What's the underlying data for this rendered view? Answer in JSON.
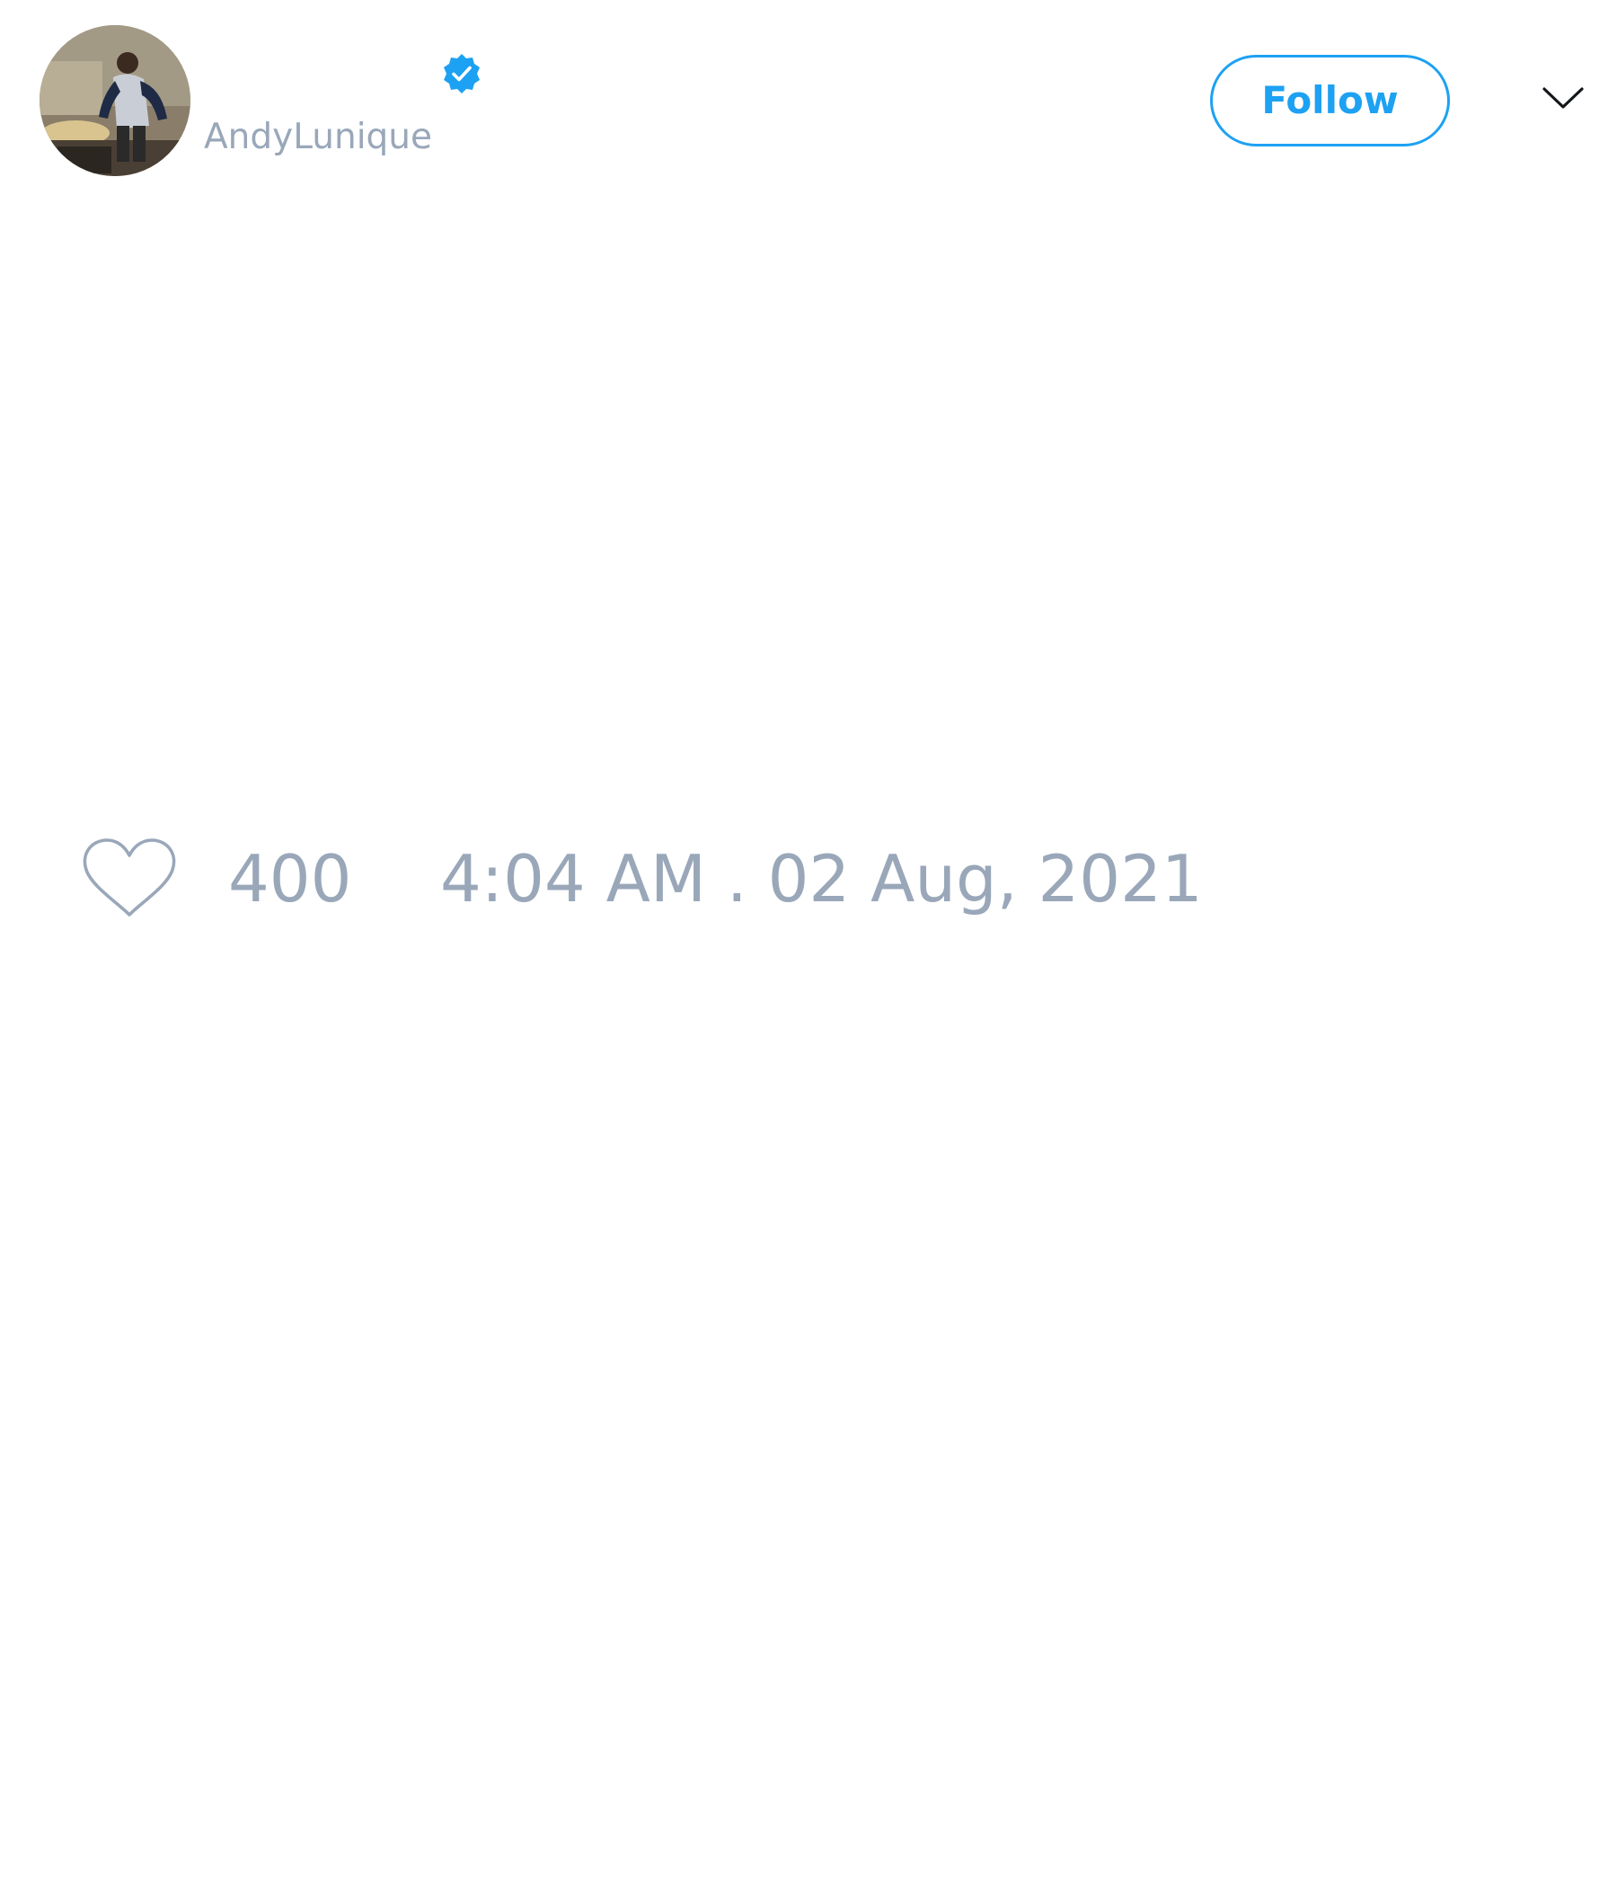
{
  "user": {
    "handle": "AndyLunique",
    "verified": true,
    "avatar_icon": "profile-photo"
  },
  "actions": {
    "follow_label": "Follow",
    "menu_icon": "chevron-down-icon"
  },
  "stats": {
    "like_icon": "heart-outline-icon",
    "likes": "400",
    "timestamp": "4:04 AM . 02 Aug, 2021"
  },
  "colors": {
    "accent": "#1da1f2",
    "muted_text": "#99a7b9",
    "background": "#ffffff"
  }
}
